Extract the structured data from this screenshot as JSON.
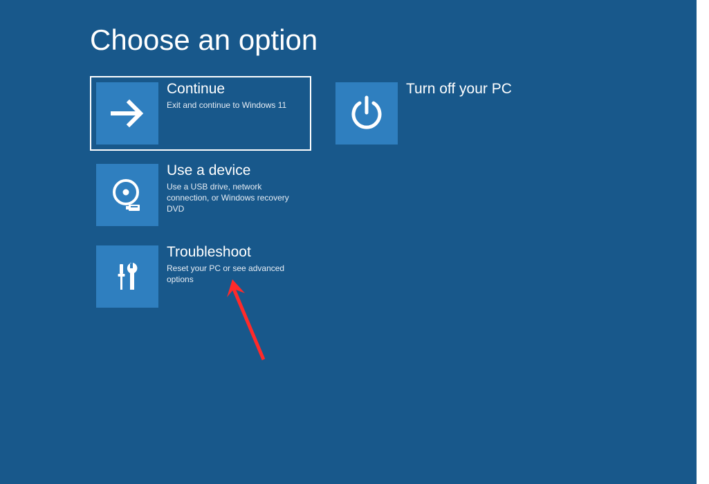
{
  "title": "Choose an option",
  "tiles": {
    "continue": {
      "title": "Continue",
      "desc": "Exit and continue to Windows 11"
    },
    "turnoff": {
      "title": "Turn off your PC",
      "desc": ""
    },
    "device": {
      "title": "Use a device",
      "desc": "Use a USB drive, network connection, or Windows recovery DVD"
    },
    "troubleshoot": {
      "title": "Troubleshoot",
      "desc": "Reset your PC or see advanced options"
    }
  },
  "colors": {
    "background": "#18588b",
    "tile": "#2f7fbf",
    "annotation": "#ff2a2a"
  }
}
